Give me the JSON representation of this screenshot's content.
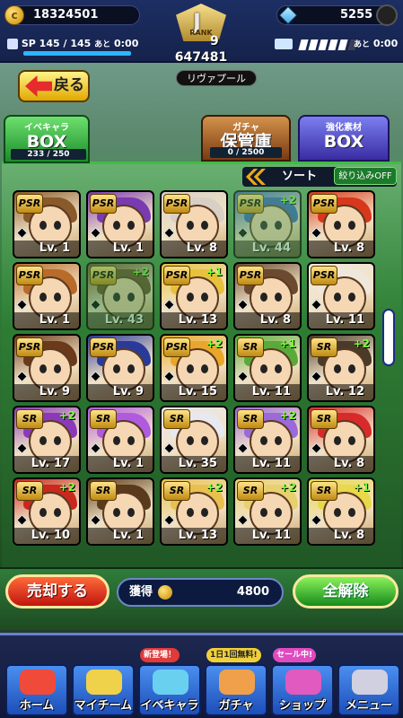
{
  "header": {
    "coins": "18324501",
    "gems": "5255",
    "sp_label": "SP",
    "sp_value": "145",
    "sp_max": "/ 145",
    "sp_suffix": "あと",
    "sp_timer": "0:00",
    "stamina_suffix": "あと",
    "stamina_timer": "0:00",
    "rank_label": "RANK",
    "rank_letter": "J",
    "rank_level": "9",
    "rank_points": "647481",
    "team_name": "リヴァプール"
  },
  "back_label": "戻る",
  "tabs": [
    {
      "small": "イベキャラ",
      "large": "BOX",
      "count": "233 / 250"
    },
    {
      "small": "ガチャ",
      "large": "保管庫",
      "count": "0 / 2500"
    },
    {
      "small": "強化素材",
      "large": "BOX",
      "count": ""
    }
  ],
  "sort_label": "ソート",
  "filter_label": "絞り込みOFF",
  "cards": [
    {
      "rarity": "PSR",
      "level": "Lv. 1",
      "plus": "",
      "hair": "#8a5a2b"
    },
    {
      "rarity": "PSR",
      "level": "Lv. 1",
      "plus": "",
      "hair": "#7a3ab0"
    },
    {
      "rarity": "PSR",
      "level": "Lv. 8",
      "plus": "",
      "hair": "#d8d0c4"
    },
    {
      "rarity": "PSR",
      "level": "Lv. 44",
      "plus": "+2",
      "hair": "#2e5fc0"
    },
    {
      "rarity": "PSR",
      "level": "Lv. 8",
      "plus": "",
      "hair": "#d8371c"
    },
    {
      "rarity": "PSR",
      "level": "Lv. 1",
      "plus": "",
      "hair": "#b86b2a"
    },
    {
      "rarity": "PSR",
      "level": "Lv. 43",
      "plus": "+2",
      "hair": "#6b4a2a"
    },
    {
      "rarity": "PSR",
      "level": "Lv. 13",
      "plus": "+1",
      "hair": "#e8c13c"
    },
    {
      "rarity": "PSR",
      "level": "Lv. 8",
      "plus": "",
      "hair": "#6b4a30"
    },
    {
      "rarity": "PSR",
      "level": "Lv. 11",
      "plus": "",
      "hair": "#efe7db"
    },
    {
      "rarity": "PSR",
      "level": "Lv. 9",
      "plus": "",
      "hair": "#6b3a1a"
    },
    {
      "rarity": "PSR",
      "level": "Lv. 9",
      "plus": "",
      "hair": "#2a3a9a"
    },
    {
      "rarity": "PSR",
      "level": "Lv. 15",
      "plus": "+2",
      "hair": "#e9a62a"
    },
    {
      "rarity": "SR",
      "level": "Lv. 11",
      "plus": "+1",
      "hair": "#5aaa3a"
    },
    {
      "rarity": "SR",
      "level": "Lv. 12",
      "plus": "+2",
      "hair": "#4a3a2a"
    },
    {
      "rarity": "SR",
      "level": "Lv. 17",
      "plus": "+2",
      "hair": "#8a3ab8"
    },
    {
      "rarity": "SR",
      "level": "Lv. 1",
      "plus": "",
      "hair": "#b05ae0"
    },
    {
      "rarity": "SR",
      "level": "Lv. 35",
      "plus": "",
      "hair": "#e8e8f0"
    },
    {
      "rarity": "SR",
      "level": "Lv. 11",
      "plus": "+2",
      "hair": "#9b6ad8"
    },
    {
      "rarity": "SR",
      "level": "Lv. 8",
      "plus": "",
      "hair": "#d82a2a"
    },
    {
      "rarity": "SR",
      "level": "Lv. 10",
      "plus": "+2",
      "hair": "#c8281e"
    },
    {
      "rarity": "SR",
      "level": "Lv. 1",
      "plus": "",
      "hair": "#5a3a1a"
    },
    {
      "rarity": "SR",
      "level": "Lv. 13",
      "plus": "+2",
      "hair": "#e8c050"
    },
    {
      "rarity": "SR",
      "level": "Lv. 11",
      "plus": "+2",
      "hair": "#e8d070"
    },
    {
      "rarity": "SR",
      "level": "Lv. 8",
      "plus": "+1",
      "hair": "#e8d84a"
    }
  ],
  "sell_label": "売却する",
  "gain_label": "獲得",
  "gain_value": "4800",
  "release_label": "全解除",
  "menu": [
    {
      "label": "ホーム",
      "tag": ""
    },
    {
      "label": "マイチーム",
      "tag": ""
    },
    {
      "label": "イベキャラ",
      "tag": "新登場！"
    },
    {
      "label": "ガチャ",
      "tag": "1日1回無料!"
    },
    {
      "label": "ショップ",
      "tag": "セール中!"
    },
    {
      "label": "メニュー",
      "tag": ""
    }
  ],
  "colors": {
    "accent": "#3fbf41",
    "header": "#1c2e63"
  }
}
